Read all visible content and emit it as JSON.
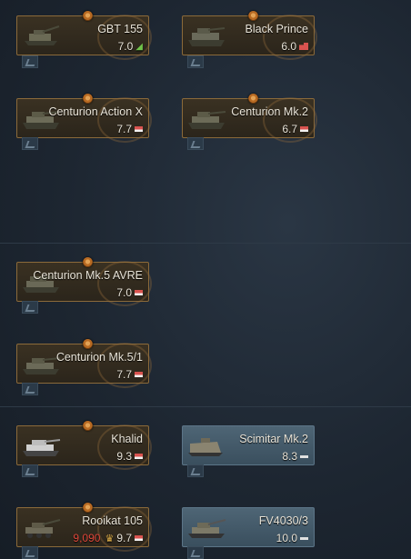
{
  "vehicles": [
    {
      "name": "GBT 155",
      "br": "7.0",
      "rank_icon": "green-arrow-icon",
      "type": "premium"
    },
    {
      "name": "Black Prince",
      "br": "6.0",
      "rank_icon": "red-crew-icon",
      "type": "premium"
    },
    {
      "name": "Centurion Action X",
      "br": "7.7",
      "rank_icon": "red-flag-icon",
      "type": "premium"
    },
    {
      "name": "Centurion Mk.2",
      "br": "6.7",
      "rank_icon": "red-flag-icon",
      "type": "premium"
    },
    {
      "name": "Centurion Mk.5 AVRE",
      "br": "7.0",
      "rank_icon": "red-flag-icon",
      "type": "premium"
    },
    {
      "name": "Centurion Mk.5/1",
      "br": "7.7",
      "rank_icon": "red-flag-icon",
      "type": "premium"
    },
    {
      "name": "Khalid",
      "br": "9.3",
      "rank_icon": "red-flag-icon",
      "type": "premium"
    },
    {
      "name": "Scimitar Mk.2",
      "br": "8.3",
      "rank_icon": "white-bar-icon",
      "type": "research"
    },
    {
      "name": "Rooikat 105",
      "br": "9.7",
      "cost": "9,090",
      "rank_icon": "red-flag-icon",
      "type": "premium"
    },
    {
      "name": "FV4030/3",
      "br": "10.0",
      "rank_icon": "white-bar-icon",
      "type": "research"
    }
  ],
  "colors": {
    "premium_border": "#8b6a3a",
    "research_bg": "#4e6575",
    "cost": "#e0473a"
  }
}
